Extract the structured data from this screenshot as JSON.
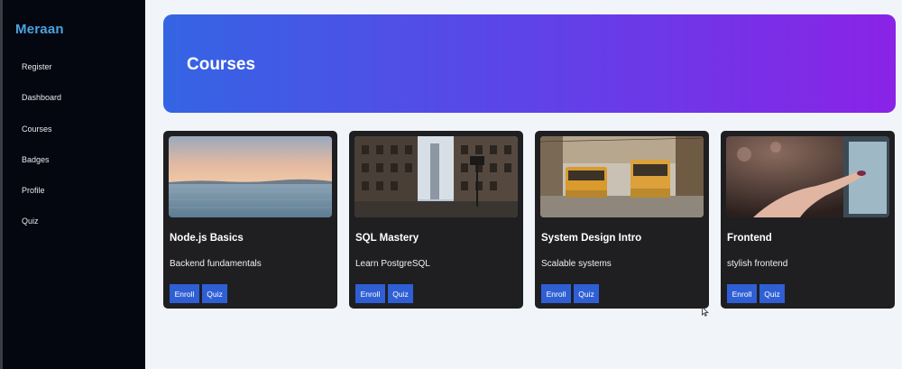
{
  "sidebar": {
    "brand": "Meraan",
    "items": [
      {
        "label": "Register"
      },
      {
        "label": "Dashboard"
      },
      {
        "label": "Courses"
      },
      {
        "label": "Badges"
      },
      {
        "label": "Profile"
      },
      {
        "label": "Quiz"
      }
    ]
  },
  "hero": {
    "title": "Courses",
    "gradient": [
      "#3465e3",
      "#8a23e6"
    ]
  },
  "courses": [
    {
      "title": "Node.js Basics",
      "description": "Backend fundamentals",
      "enroll_label": "Enroll",
      "quiz_label": "Quiz",
      "image": "sea-horizon-photo"
    },
    {
      "title": "SQL Mastery",
      "description": "Learn PostgreSQL",
      "enroll_label": "Enroll",
      "quiz_label": "Quiz",
      "image": "city-street-photo"
    },
    {
      "title": "System Design Intro",
      "description": "Scalable systems",
      "enroll_label": "Enroll",
      "quiz_label": "Quiz",
      "image": "tram-street-photo"
    },
    {
      "title": "Frontend",
      "description": "stylish frontend",
      "enroll_label": "Enroll",
      "quiz_label": "Quiz",
      "image": "touchscreen-hand-photo"
    }
  ],
  "colors": {
    "sidebar_bg": "#04070f",
    "brand": "#4aa3e0",
    "card_bg": "#1f1f22",
    "button": "#2f5fd4",
    "page_bg": "#f1f4f8"
  }
}
